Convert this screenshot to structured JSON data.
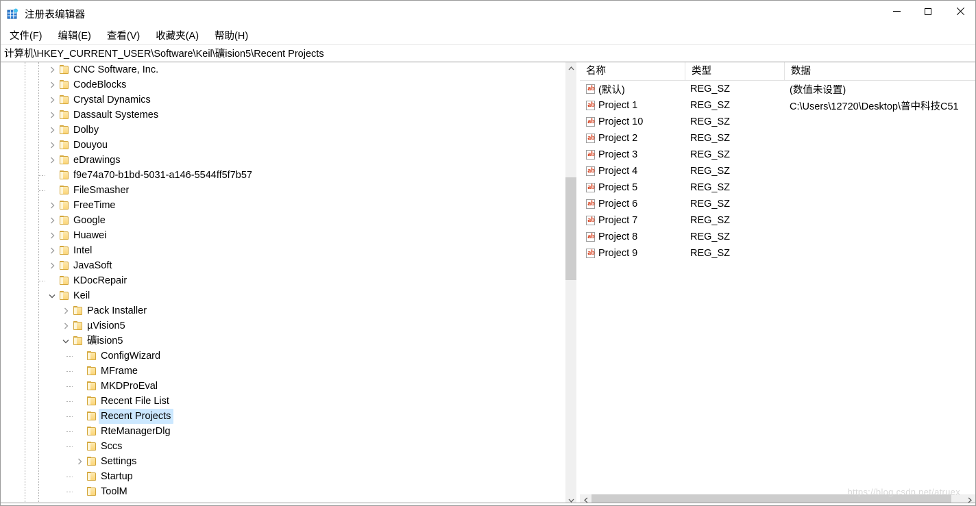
{
  "window": {
    "title": "注册表编辑器",
    "icon": "registry-editor-icon",
    "minimize_label": "最小化",
    "maximize_label": "最大化",
    "close_label": "关闭"
  },
  "menubar": {
    "items": [
      {
        "label": "文件(F)",
        "name": "menu-file"
      },
      {
        "label": "编辑(E)",
        "name": "menu-edit"
      },
      {
        "label": "查看(V)",
        "name": "menu-view"
      },
      {
        "label": "收藏夹(A)",
        "name": "menu-favorites"
      },
      {
        "label": "帮助(H)",
        "name": "menu-help"
      }
    ]
  },
  "address": {
    "path": "计算机\\HKEY_CURRENT_USER\\Software\\Keil\\礦ision5\\Recent Projects"
  },
  "tree": {
    "nodes": [
      {
        "label": "CNC Software, Inc.",
        "indent": 1,
        "state": "collapsed",
        "selected": false
      },
      {
        "label": "CodeBlocks",
        "indent": 1,
        "state": "collapsed",
        "selected": false
      },
      {
        "label": "Crystal Dynamics",
        "indent": 1,
        "state": "collapsed",
        "selected": false
      },
      {
        "label": "Dassault Systemes",
        "indent": 1,
        "state": "collapsed",
        "selected": false
      },
      {
        "label": "Dolby",
        "indent": 1,
        "state": "collapsed",
        "selected": false
      },
      {
        "label": "Douyou",
        "indent": 1,
        "state": "collapsed",
        "selected": false
      },
      {
        "label": "eDrawings",
        "indent": 1,
        "state": "collapsed",
        "selected": false
      },
      {
        "label": "f9e74a70-b1bd-5031-a146-5544ff5f7b57",
        "indent": 1,
        "state": "leaf",
        "selected": false
      },
      {
        "label": "FileSmasher",
        "indent": 1,
        "state": "leaf",
        "selected": false
      },
      {
        "label": "FreeTime",
        "indent": 1,
        "state": "collapsed",
        "selected": false
      },
      {
        "label": "Google",
        "indent": 1,
        "state": "collapsed",
        "selected": false
      },
      {
        "label": "Huawei",
        "indent": 1,
        "state": "collapsed",
        "selected": false
      },
      {
        "label": "Intel",
        "indent": 1,
        "state": "collapsed",
        "selected": false
      },
      {
        "label": "JavaSoft",
        "indent": 1,
        "state": "collapsed",
        "selected": false
      },
      {
        "label": "KDocRepair",
        "indent": 1,
        "state": "leaf",
        "selected": false
      },
      {
        "label": "Keil",
        "indent": 1,
        "state": "expanded",
        "selected": false
      },
      {
        "label": "Pack Installer",
        "indent": 2,
        "state": "collapsed",
        "selected": false
      },
      {
        "label": "µVision5",
        "indent": 2,
        "state": "collapsed",
        "selected": false
      },
      {
        "label": "礦ision5",
        "indent": 2,
        "state": "expanded",
        "selected": false
      },
      {
        "label": "ConfigWizard",
        "indent": 3,
        "state": "leaf",
        "selected": false
      },
      {
        "label": "MFrame",
        "indent": 3,
        "state": "leaf",
        "selected": false
      },
      {
        "label": "MKDProEval",
        "indent": 3,
        "state": "leaf",
        "selected": false
      },
      {
        "label": "Recent File List",
        "indent": 3,
        "state": "leaf",
        "selected": false
      },
      {
        "label": "Recent Projects",
        "indent": 3,
        "state": "leaf",
        "selected": true
      },
      {
        "label": "RteManagerDlg",
        "indent": 3,
        "state": "leaf",
        "selected": false
      },
      {
        "label": "Sccs",
        "indent": 3,
        "state": "leaf",
        "selected": false
      },
      {
        "label": "Settings",
        "indent": 3,
        "state": "collapsed",
        "selected": false
      },
      {
        "label": "Startup",
        "indent": 3,
        "state": "leaf",
        "selected": false
      },
      {
        "label": "ToolM",
        "indent": 3,
        "state": "leaf",
        "selected": false
      }
    ]
  },
  "list": {
    "columns": [
      {
        "label": "名称",
        "name": "column-name"
      },
      {
        "label": "类型",
        "name": "column-type"
      },
      {
        "label": "数据",
        "name": "column-data"
      }
    ],
    "rows": [
      {
        "name": "(默认)",
        "type": "REG_SZ",
        "data": "(数值未设置)"
      },
      {
        "name": "Project 1",
        "type": "REG_SZ",
        "data": "C:\\Users\\12720\\Desktop\\普中科技C51"
      },
      {
        "name": "Project 10",
        "type": "REG_SZ",
        "data": ""
      },
      {
        "name": "Project 2",
        "type": "REG_SZ",
        "data": ""
      },
      {
        "name": "Project 3",
        "type": "REG_SZ",
        "data": ""
      },
      {
        "name": "Project 4",
        "type": "REG_SZ",
        "data": ""
      },
      {
        "name": "Project 5",
        "type": "REG_SZ",
        "data": ""
      },
      {
        "name": "Project 6",
        "type": "REG_SZ",
        "data": ""
      },
      {
        "name": "Project 7",
        "type": "REG_SZ",
        "data": ""
      },
      {
        "name": "Project 8",
        "type": "REG_SZ",
        "data": ""
      },
      {
        "name": "Project 9",
        "type": "REG_SZ",
        "data": ""
      }
    ],
    "value_icon": "ab"
  },
  "watermark": {
    "text": "https://blog.csdn.net/atruex"
  },
  "colors": {
    "selection": "#cce8ff",
    "folder": "#fbd67a",
    "value_icon_text": "#d63b18",
    "scrollbar_thumb": "#cdcdcd",
    "scrollbar_track": "#f0f0f0"
  }
}
